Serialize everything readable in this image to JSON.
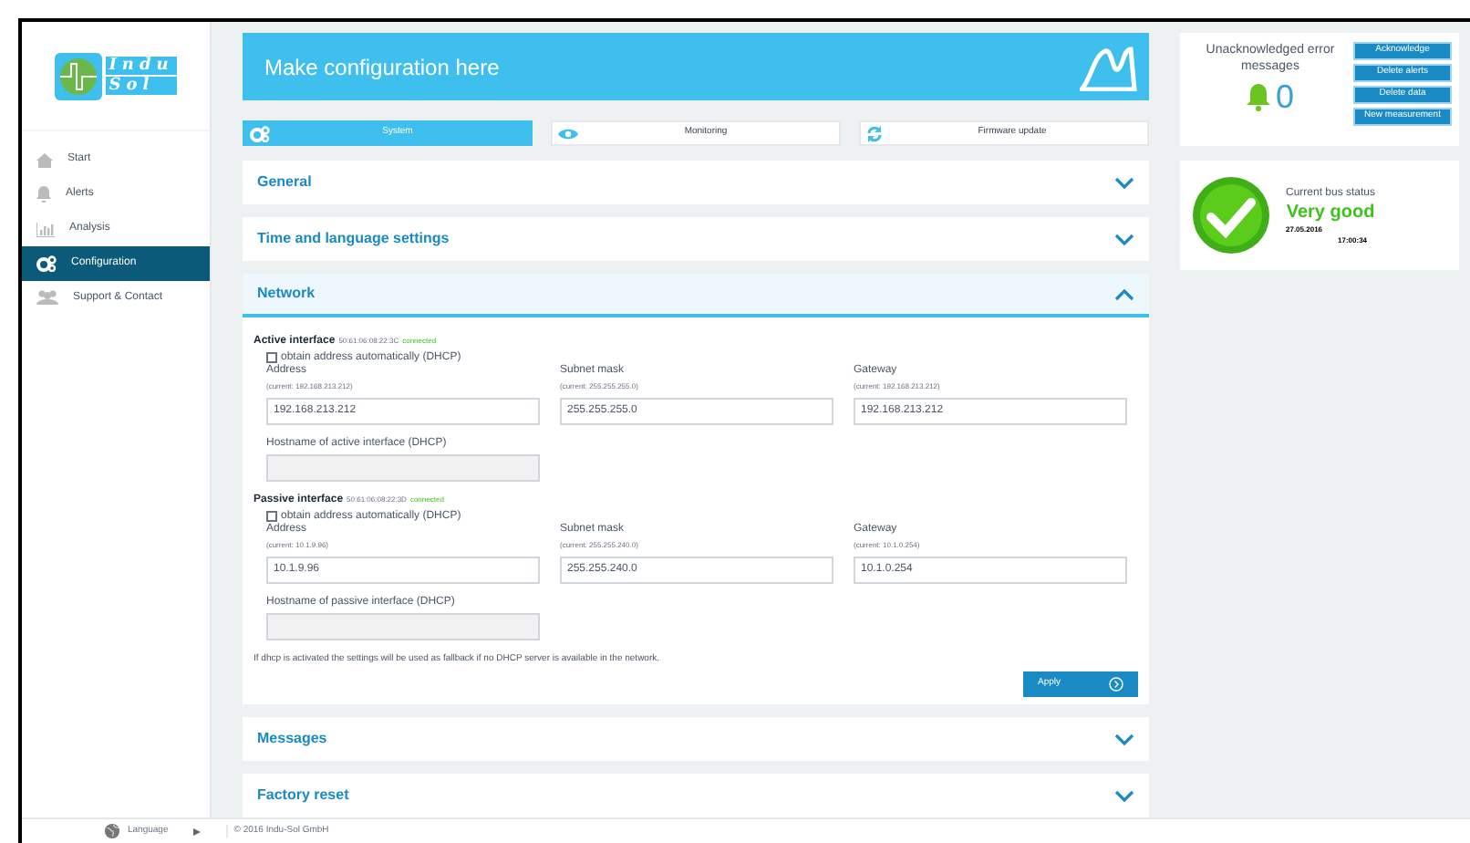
{
  "logo": {
    "rows": [
      "Indu",
      "Sol"
    ]
  },
  "sidebar": {
    "items": [
      {
        "label": "Start",
        "selected": false
      },
      {
        "label": "Alerts",
        "selected": false
      },
      {
        "label": "Analysis",
        "selected": false
      },
      {
        "label": "Configuration",
        "selected": true
      },
      {
        "label": "Support & Contact",
        "selected": false
      }
    ]
  },
  "banner": {
    "title": "Make configuration here"
  },
  "tabs": [
    {
      "label": "System",
      "selected": true
    },
    {
      "label": "Monitoring",
      "selected": false
    },
    {
      "label": "Firmware update",
      "selected": false
    }
  ],
  "sections": [
    {
      "title": "General",
      "expanded": false
    },
    {
      "title": "Time and language settings",
      "expanded": false
    },
    {
      "title": "Network",
      "expanded": true
    },
    {
      "title": "Messages",
      "expanded": false
    },
    {
      "title": "Factory reset",
      "expanded": false
    }
  ],
  "network": {
    "interfaces": [
      {
        "title": "Active interface",
        "mac": "50:61:06:08:22:3C",
        "status": "connected",
        "dhcp": {
          "label": "obtain address automatically (DHCP)",
          "checked": false
        },
        "fields": [
          {
            "label": "Address",
            "current": "(current: 192.168.213.212)",
            "value": "192.168.213.212"
          },
          {
            "label": "Subnet mask",
            "current": "(current: 255.255.255.0)",
            "value": "255.255.255.0"
          },
          {
            "label": "Gateway",
            "current": "(current: 192.168.213.212)",
            "value": "192.168.213.212"
          }
        ],
        "hostname": "Hostname of active interface (DHCP)"
      },
      {
        "title": "Passive interface",
        "mac": "50:61:06:08:22:3D",
        "status": "connected",
        "dhcp": {
          "label": "obtain address automatically (DHCP)",
          "checked": false
        },
        "fields": [
          {
            "label": "Address",
            "current": "(current: 10.1.9.96)",
            "value": "10.1.9.96"
          },
          {
            "label": "Subnet mask",
            "current": "(current: 255.255.240.0)",
            "value": "255.255.240.0"
          },
          {
            "label": "Gateway",
            "current": "(current: 10.1.0.254)",
            "value": "10.1.0.254"
          }
        ],
        "hostname": "Hostname of passive interface (DHCP)"
      }
    ],
    "note": "If dhcp is activated the settings will be used as fallback if no DHCP server is available in the network.",
    "apply": "Apply"
  },
  "errors": {
    "title": "Unacknowledged error messages",
    "count": "0",
    "buttons": [
      "Acknowledge",
      "Delete alerts",
      "Delete data",
      "New measurement"
    ]
  },
  "bus_status": {
    "label": "Current bus status",
    "value": "Very good",
    "date": "27.05.2016",
    "time": "17:00:34"
  },
  "footer": {
    "language": "Language",
    "copyright": "© 2016 Indu-Sol GmbH"
  }
}
